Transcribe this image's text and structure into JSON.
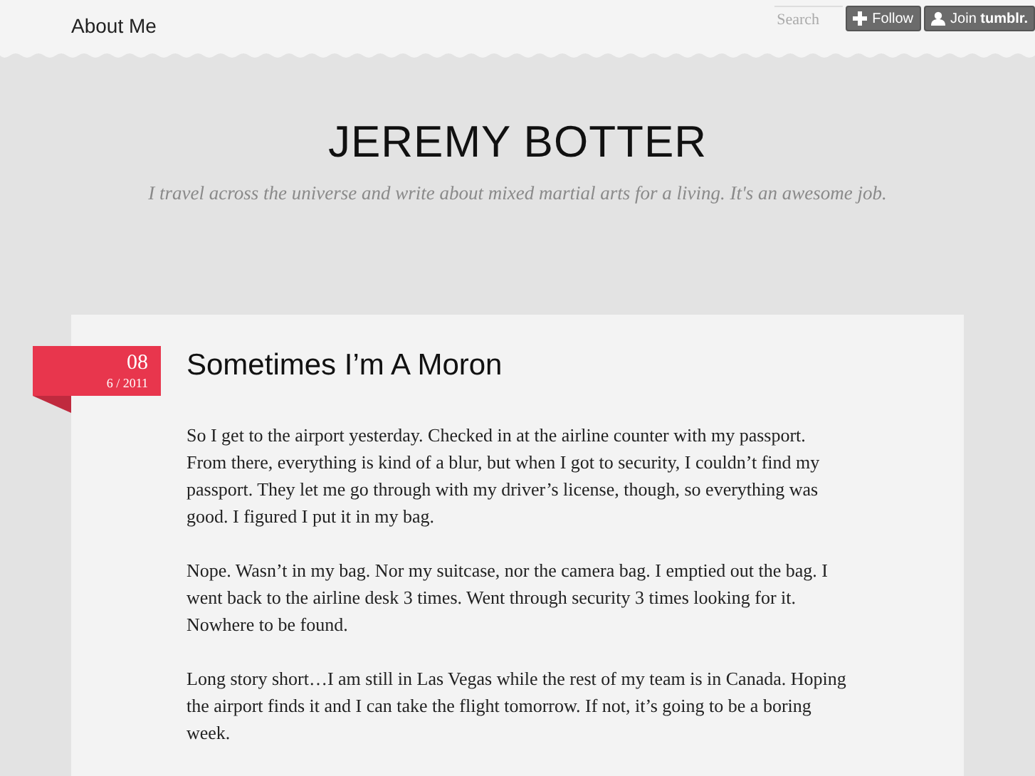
{
  "top_bar": {
    "nav_link": "About Me",
    "search": {
      "placeholder": "Search"
    },
    "follow_button": "Follow",
    "join_button": "Join **tumblr.**"
  },
  "header": {
    "title": "JEREMY BOTTER",
    "tagline": "I travel across the universe and write about mixed martial arts for a living. It's an awesome job."
  },
  "post": {
    "date": {
      "day": "08",
      "month_year": "6 / 2011"
    },
    "title": "Sometimes I’m A Moron",
    "paragraphs": [
      "So I get to the airport yesterday. Checked in at the airline counter with my passport. From there, everything is kind of a blur, but when I got to security, I couldn’t find my passport. They let me go through with my driver’s license, though, so everything was good. I figured I put it in my bag.",
      "Nope. Wasn’t in my bag. Nor my suitcase, nor the camera bag. I emptied out the bag. I went back to the airline desk 3 times. Went through security 3 times looking for it. Nowhere to be found.",
      "Long story short…I am still in Las Vegas while the rest of my team is in Canada. Hoping the airport finds it and I can take the flight tomorrow. If not, it’s going to be a boring week."
    ]
  }
}
